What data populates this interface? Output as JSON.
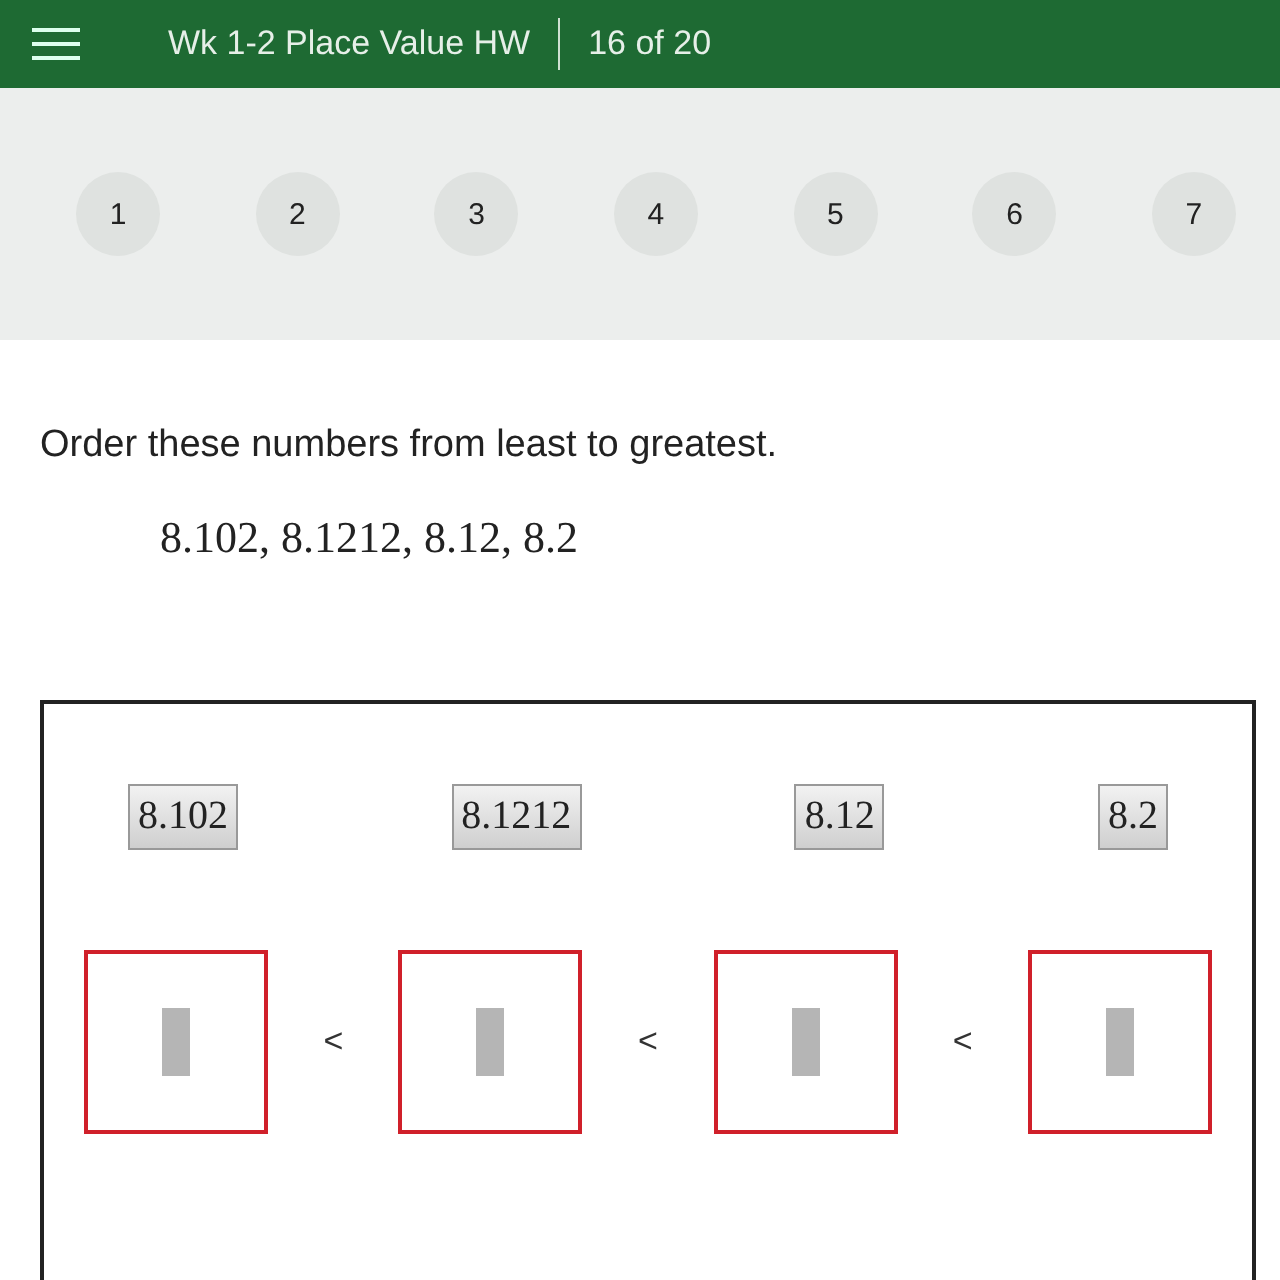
{
  "header": {
    "title": "Wk 1-2 Place Value HW",
    "progress": "16 of 20"
  },
  "questions": [
    {
      "label": "1",
      "selected": false
    },
    {
      "label": "2",
      "selected": false
    },
    {
      "label": "3",
      "selected": false
    },
    {
      "label": "4",
      "selected": false
    },
    {
      "label": "5",
      "selected": false
    },
    {
      "label": "6",
      "selected": false
    },
    {
      "label": "7",
      "selected": false
    }
  ],
  "prompt": "Order these numbers from least to greatest.",
  "numbers": "8.102, 8.1212, 8.12, 8.2",
  "tiles": [
    "8.102",
    "8.1212",
    "8.12",
    "8.2"
  ],
  "comparison_signs": [
    "<",
    "<",
    "<"
  ]
}
